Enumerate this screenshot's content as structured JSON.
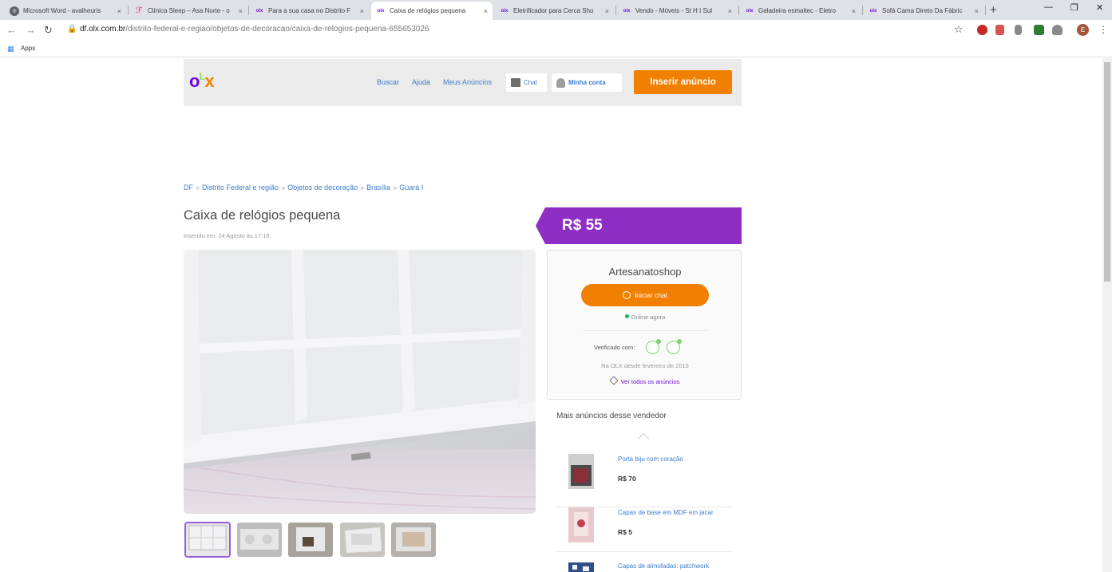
{
  "browser": {
    "tabs": [
      {
        "title": "Microsoft Word - avalheuris",
        "favicon": "globe"
      },
      {
        "title": "Clínica Sleep – Asa Norte - o",
        "favicon": "foursquare"
      },
      {
        "title": "Para a sua casa no Distrito F",
        "favicon": "olx"
      },
      {
        "title": "Caixa de relógios pequena",
        "favicon": "olx",
        "active": true
      },
      {
        "title": "Eletrificador para Cerca Sho",
        "favicon": "olx"
      },
      {
        "title": "Vendo - Móveis - St H I Sul",
        "favicon": "olx"
      },
      {
        "title": "Geladeira esmaltec - Eletro",
        "favicon": "olx"
      },
      {
        "title": "Sofá Cama Direto Da Fábric",
        "favicon": "olx"
      }
    ],
    "tab_close": "×",
    "new_tab": "+",
    "window": {
      "minimize": "—",
      "maximize": "❐",
      "close": "✕"
    },
    "nav": {
      "back": "←",
      "forward": "→",
      "reload": "↻"
    },
    "url_domain": "df.olx.com.br",
    "url_path": "/distrito-federal-e-regiao/objetos-de-decoracao/caixa-de-relogios-pequena-655653026",
    "bookmark_star": "☆",
    "profile_initial": "E",
    "menu": "⋮",
    "bookmarks": {
      "apps_label": "Apps"
    }
  },
  "olx": {
    "logo": {
      "o": "o",
      "l": "L",
      "x": "x"
    },
    "nav": {
      "buscar": "Buscar",
      "ajuda": "Ajuda",
      "meus_anuncios": "Meus Anúncios"
    },
    "chat_label": "Chat",
    "account_label": "Minha conta",
    "insert_label": "Inserir anúncio",
    "colors": {
      "orange": "#f28000",
      "purple": "#8e2ec4",
      "link": "#3d7cc9",
      "green": "#7ed36f"
    }
  },
  "breadcrumb": [
    "DF",
    "Distrito Federal e região",
    "Objetos de decoração",
    "Brasília",
    "Guará I"
  ],
  "breadcrumb_sep": "»",
  "ad": {
    "title": "Caixa de relógios pequena",
    "inserted": "Inserido em: 24 Agosto às 17:16.",
    "price": "R$ 55"
  },
  "seller": {
    "name": "Artesanatoshop",
    "chat_button": "Iniciar chat",
    "status": "Online agora",
    "verified_label": "Verificado com:",
    "since": "Na OLX desde fevereiro de 2015",
    "see_all": "Ver todos os anúncios"
  },
  "more_ads": {
    "title": "Mais anúncios desse vendedor",
    "items": [
      {
        "name": "Porta biju com coração",
        "price": "R$ 70"
      },
      {
        "name": "Capas de base em MDF em jacar",
        "price": "R$ 5"
      },
      {
        "name": "Capas de almofadas: patchwork",
        "price": ""
      }
    ]
  }
}
